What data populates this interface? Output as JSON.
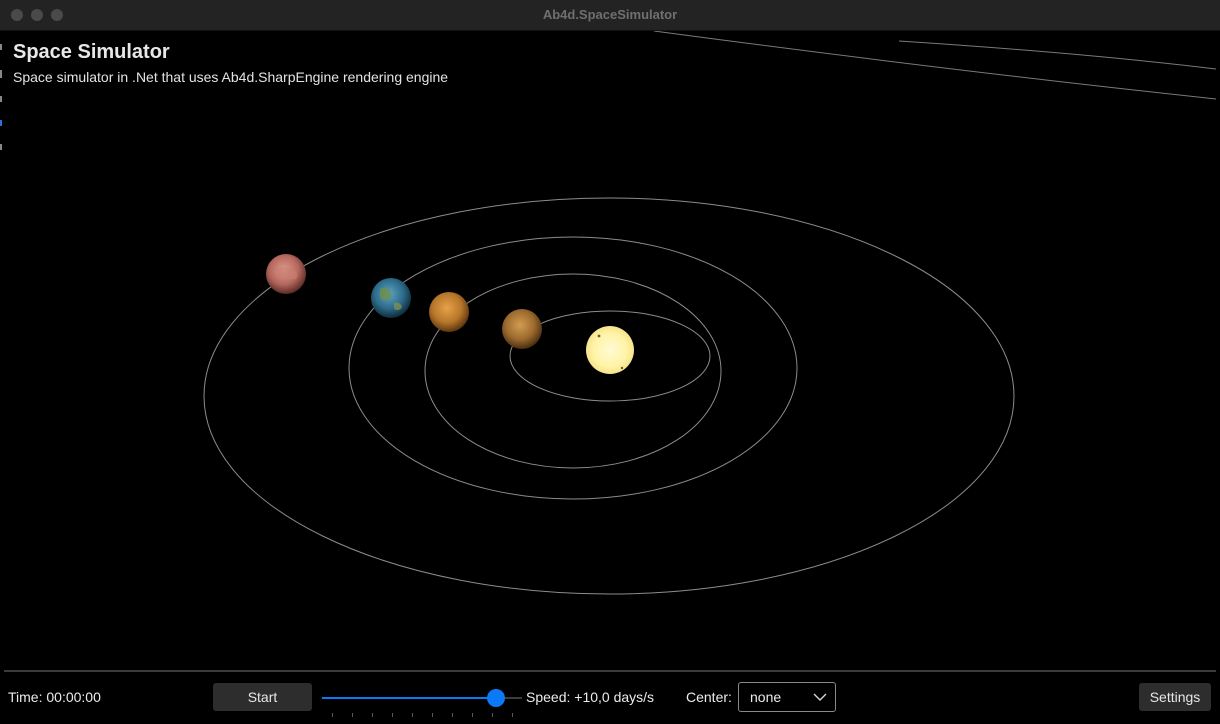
{
  "window": {
    "title": "Ab4d.SpaceSimulator"
  },
  "app": {
    "title": "Space Simulator",
    "subtitle": "Space simulator in .Net that uses Ab4d.SharpEngine rendering engine"
  },
  "scene": {
    "bodies": [
      {
        "name": "sun",
        "color": "#fff4a8",
        "icon": "sun-icon"
      },
      {
        "name": "mercury",
        "color": "#9c6a2e",
        "icon": "planet-icon"
      },
      {
        "name": "venus",
        "color": "#b7772a",
        "icon": "planet-icon"
      },
      {
        "name": "earth",
        "color": "#2d6c8a",
        "icon": "planet-icon"
      },
      {
        "name": "mars",
        "color": "#b5675d",
        "icon": "planet-icon"
      }
    ],
    "orbit_color": "#8c8c8c"
  },
  "controls": {
    "time_label": "Time: 00:00:00",
    "start_label": "Start",
    "speed_label": "Speed: +10,0 days/s",
    "speed_slider_fraction": 0.87,
    "center_label": "Center:",
    "center_value": "none",
    "settings_label": "Settings",
    "accent_color": "#0a7af7"
  }
}
